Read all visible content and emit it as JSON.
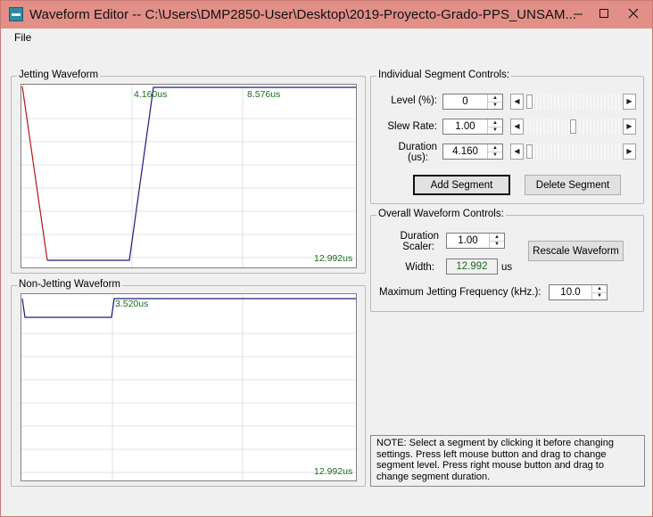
{
  "window": {
    "title": "Waveform Editor -- C:\\Users\\DMP2850-User\\Desktop\\2019-Proyecto-Grado-PPS_UNSAM..."
  },
  "menu": {
    "file": "File"
  },
  "jetting": {
    "title": "Jetting Waveform",
    "marker1": "4.160us",
    "marker2": "8.576us",
    "total": "12.992us"
  },
  "nonjetting": {
    "title": "Non-Jetting Waveform",
    "marker1": "3.520us",
    "total": "12.992us"
  },
  "segment": {
    "title": "Individual Segment Controls:",
    "level_label": "Level (%):",
    "level_value": "0",
    "level_fraction": 0.03,
    "slew_label": "Slew Rate:",
    "slew_value": "1.00",
    "slew_fraction": 0.5,
    "duration_label_1": "Duration",
    "duration_label_2": "(us):",
    "duration_value": "4.160",
    "duration_fraction": 0.03,
    "add_label": "Add Segment",
    "delete_label": "Delete Segment"
  },
  "overall": {
    "title": "Overall Waveform Controls:",
    "scaler_label_1": "Duration",
    "scaler_label_2": "Scaler:",
    "scaler_value": "1.00",
    "rescale_label": "Rescale Waveform",
    "width_label": "Width:",
    "width_value": "12.992",
    "width_unit": "us",
    "freq_label": "Maximum Jetting Frequency (kHz.):",
    "freq_value": "10.0"
  },
  "note": "NOTE: Select a segment by clicking it before changing settings.  Press left mouse button and drag to change segment level.   Press right mouse button and drag to change segment duration.",
  "colors": {
    "titlebar": "#e28f88",
    "marker_text": "#1c6a1c",
    "wave_blue": "#1a1a80",
    "wave_red": "#b01818"
  }
}
